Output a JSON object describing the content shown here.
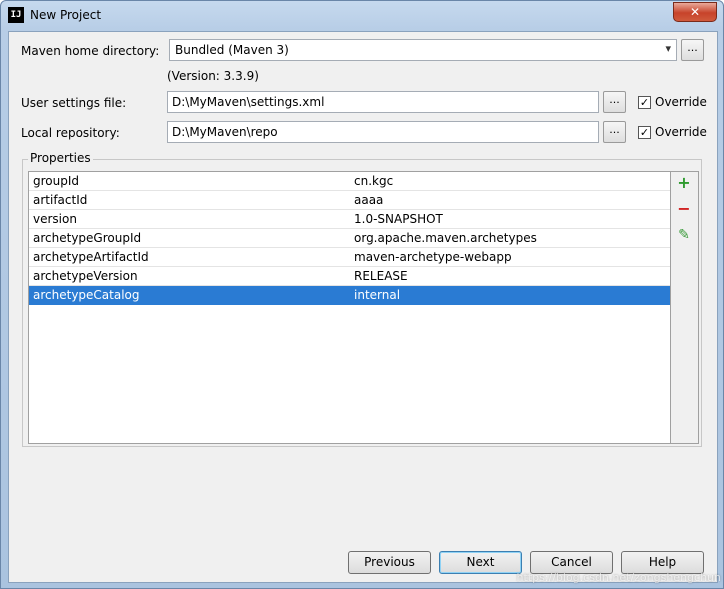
{
  "window": {
    "title": "New Project",
    "app_icon_text": "IJ",
    "close_glyph": "✕"
  },
  "maven_home": {
    "label": "Maven home directory:",
    "value": "Bundled (Maven 3)",
    "version": "(Version: 3.3.9)",
    "browse_label": "..."
  },
  "user_settings": {
    "label": "User settings file:",
    "value": "D:\\MyMaven\\settings.xml",
    "browse_label": "...",
    "override_label": "Override",
    "override_checked": true
  },
  "local_repo": {
    "label": "Local repository:",
    "value": "D:\\MyMaven\\repo",
    "browse_label": "...",
    "override_label": "Override",
    "override_checked": true
  },
  "properties": {
    "title": "Properties",
    "rows": [
      {
        "key": "groupId",
        "value": "cn.kgc"
      },
      {
        "key": "artifactId",
        "value": "aaaa"
      },
      {
        "key": "version",
        "value": "1.0-SNAPSHOT"
      },
      {
        "key": "archetypeGroupId",
        "value": "org.apache.maven.archetypes"
      },
      {
        "key": "archetypeArtifactId",
        "value": "maven-archetype-webapp"
      },
      {
        "key": "archetypeVersion",
        "value": "RELEASE"
      },
      {
        "key": "archetypeCatalog",
        "value": "internal"
      }
    ],
    "selected_row": 6,
    "tools": {
      "add": "+",
      "remove": "−",
      "edit": "✎"
    }
  },
  "buttons": {
    "previous": "Previous",
    "next": "Next",
    "cancel": "Cancel",
    "help": "Help"
  },
  "watermark": "https://blog.csdn.net/zongshengchun",
  "colors": {
    "selection": "#2a7bd3",
    "add": "#2e9a2e",
    "remove": "#d02020",
    "edit": "#3a9a3a"
  }
}
